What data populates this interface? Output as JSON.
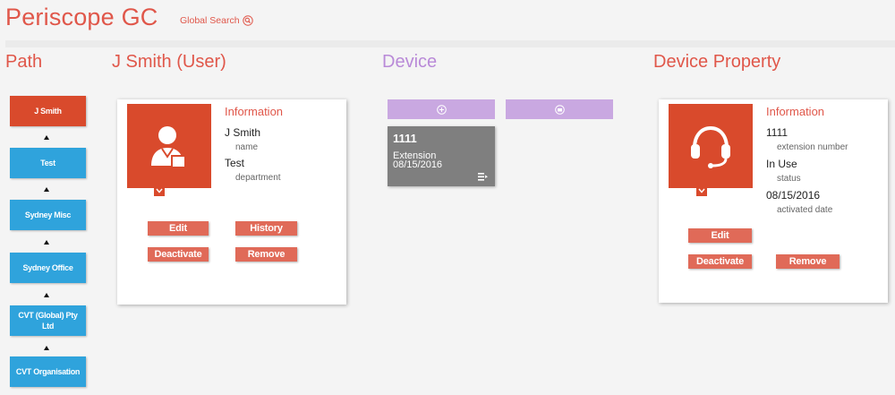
{
  "header": {
    "app_title": "Periscope GC",
    "global_search_label": "Global Search"
  },
  "sections": {
    "path": "Path",
    "user": "J Smith (User)",
    "device": "Device",
    "device_property": "Device Property"
  },
  "path_items": [
    {
      "label": "J Smith",
      "active": true
    },
    {
      "label": "Test",
      "active": false
    },
    {
      "label": "Sydney Misc",
      "active": false
    },
    {
      "label": "Sydney Office",
      "active": false
    },
    {
      "label": "CVT (Global) Pty Ltd",
      "active": false
    },
    {
      "label": "CVT Organisation",
      "active": false
    }
  ],
  "user_card": {
    "heading": "Information",
    "fields": [
      {
        "value": "J Smith",
        "label": "name"
      },
      {
        "value": "Test",
        "label": "department"
      }
    ],
    "buttons": {
      "edit": "Edit",
      "history": "History",
      "deactivate": "Deactivate",
      "remove": "Remove"
    },
    "icon": "user-icon"
  },
  "device_panel": {
    "add_icon": "plus-circle-icon",
    "filter_icon": "filter-icon",
    "tile": {
      "number": "1111",
      "type": "Extension",
      "date": "08/15/2016",
      "menu_icon": "list-menu-icon"
    }
  },
  "property_card": {
    "heading": "Information",
    "fields": [
      {
        "value": "1111",
        "label": "extension number"
      },
      {
        "value": "In Use",
        "label": "status"
      },
      {
        "value": "08/15/2016",
        "label": "activated date"
      }
    ],
    "buttons": {
      "edit": "Edit",
      "deactivate": "Deactivate",
      "remove": "Remove"
    },
    "icon": "headset-icon"
  },
  "colors": {
    "accent_red": "#d94a2c",
    "title_red": "#e0574a",
    "path_blue": "#2fa3dc",
    "device_purple": "#c9a8e1",
    "tile_gray": "#7f7f7f"
  }
}
